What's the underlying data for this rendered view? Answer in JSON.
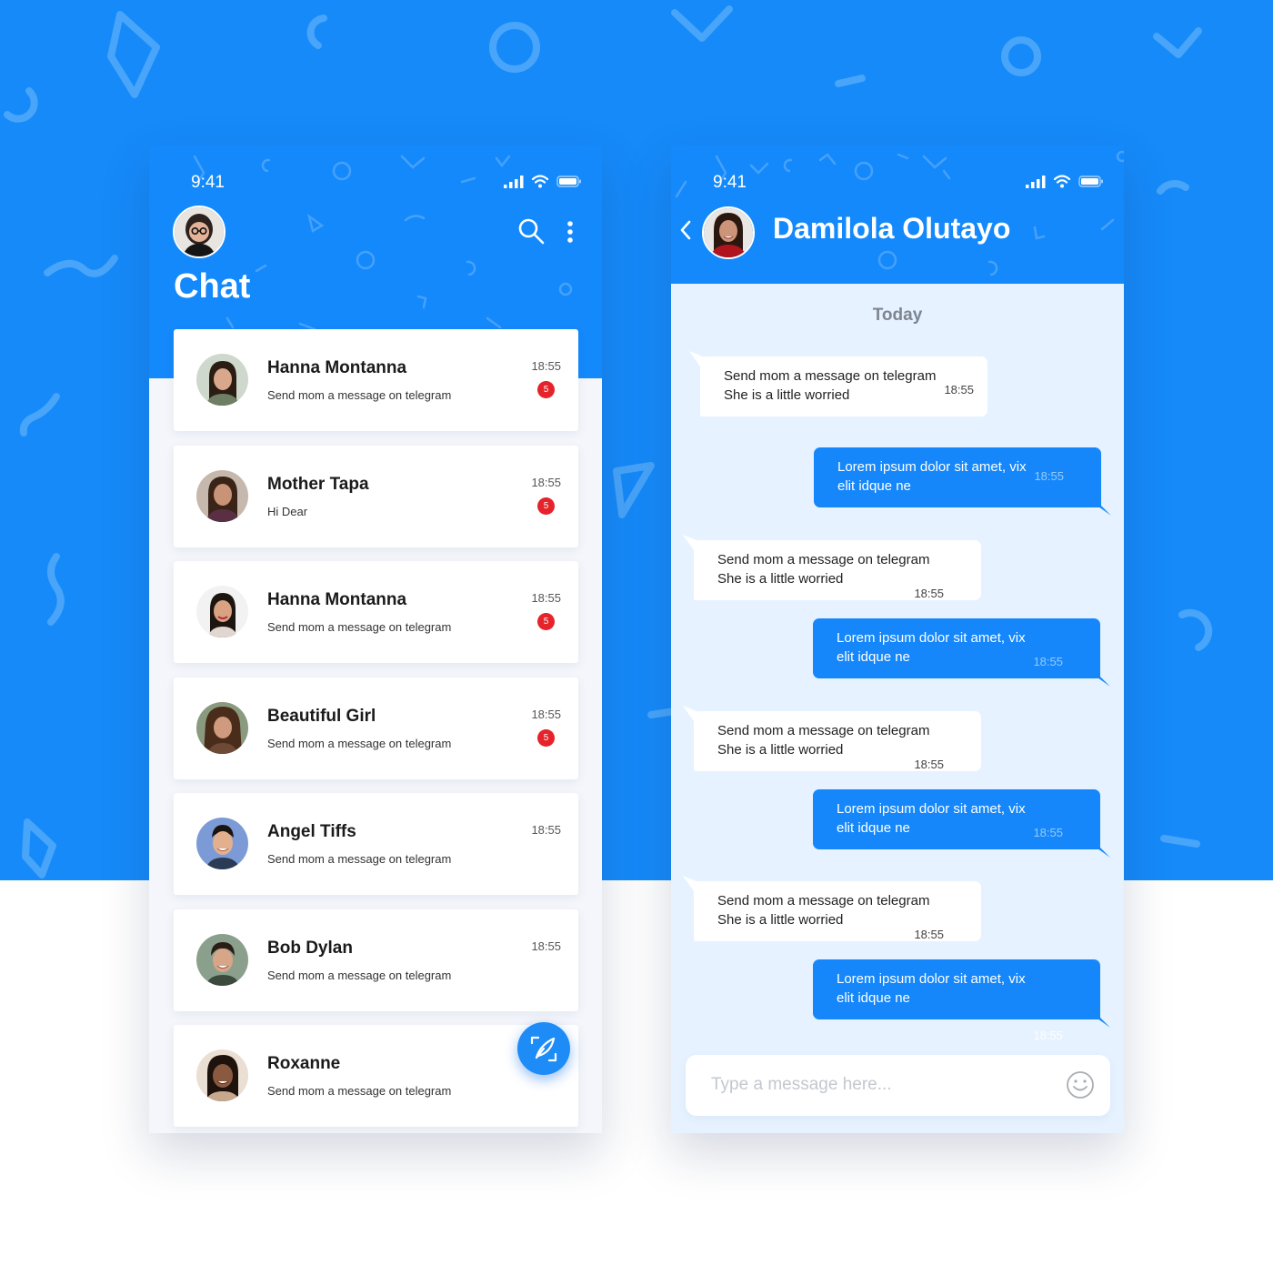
{
  "theme": {
    "primary": "#1489fb",
    "badge": "#e6222a",
    "chat_background": "#e6f2ff"
  },
  "list_screen": {
    "status_time": "9:41",
    "title": "Chat",
    "icons": [
      "profile-avatar",
      "search-icon",
      "more-vertical-icon",
      "compose-feather-icon"
    ],
    "chats": [
      {
        "name": "Hanna Montanna",
        "preview": "Send mom a message on telegram",
        "time": "18:55",
        "unread": "5"
      },
      {
        "name": "Mother Tapa",
        "preview": "Hi Dear",
        "time": "18:55",
        "unread": "5"
      },
      {
        "name": "Hanna Montanna",
        "preview": "Send mom a message on telegram",
        "time": "18:55",
        "unread": "5"
      },
      {
        "name": "Beautiful Girl",
        "preview": "Send mom a message on telegram",
        "time": "18:55",
        "unread": "5"
      },
      {
        "name": "Angel Tiffs",
        "preview": "Send mom a message on telegram",
        "time": "18:55",
        "unread": ""
      },
      {
        "name": "Bob Dylan",
        "preview": "Send mom a message on telegram",
        "time": "18:55",
        "unread": ""
      },
      {
        "name": "Roxanne",
        "preview": "Send mom a message on telegram",
        "time": "",
        "unread": ""
      }
    ]
  },
  "conversation_screen": {
    "status_time": "9:41",
    "contact_name": "Damilola Olutayo",
    "day_label": "Today",
    "messages": [
      {
        "direction": "in",
        "line1": "Send mom a message on telegram",
        "line2": "She is a little worried",
        "time": "18:55"
      },
      {
        "direction": "out",
        "line1": "Lorem ipsum dolor sit amet, vix",
        "line2": "elit idque ne",
        "time": "18:55"
      },
      {
        "direction": "in",
        "line1": "Send mom a message on telegram",
        "line2": "She is a little worried",
        "time": "18:55"
      },
      {
        "direction": "out",
        "line1": "Lorem ipsum dolor sit amet, vix",
        "line2": "elit idque ne",
        "time": "18:55"
      },
      {
        "direction": "in",
        "line1": "Send mom a message on telegram",
        "line2": "She is a little worried",
        "time": "18:55"
      },
      {
        "direction": "out",
        "line1": "Lorem ipsum dolor sit amet, vix",
        "line2": "elit idque ne",
        "time": "18:55"
      },
      {
        "direction": "in",
        "line1": "Send mom a message on telegram",
        "line2": "She is a little worried",
        "time": "18:55"
      },
      {
        "direction": "out",
        "line1": "Lorem ipsum dolor sit amet, vix",
        "line2": "elit idque ne",
        "time": "18:55"
      }
    ],
    "composer_placeholder": "Type a message here..."
  }
}
